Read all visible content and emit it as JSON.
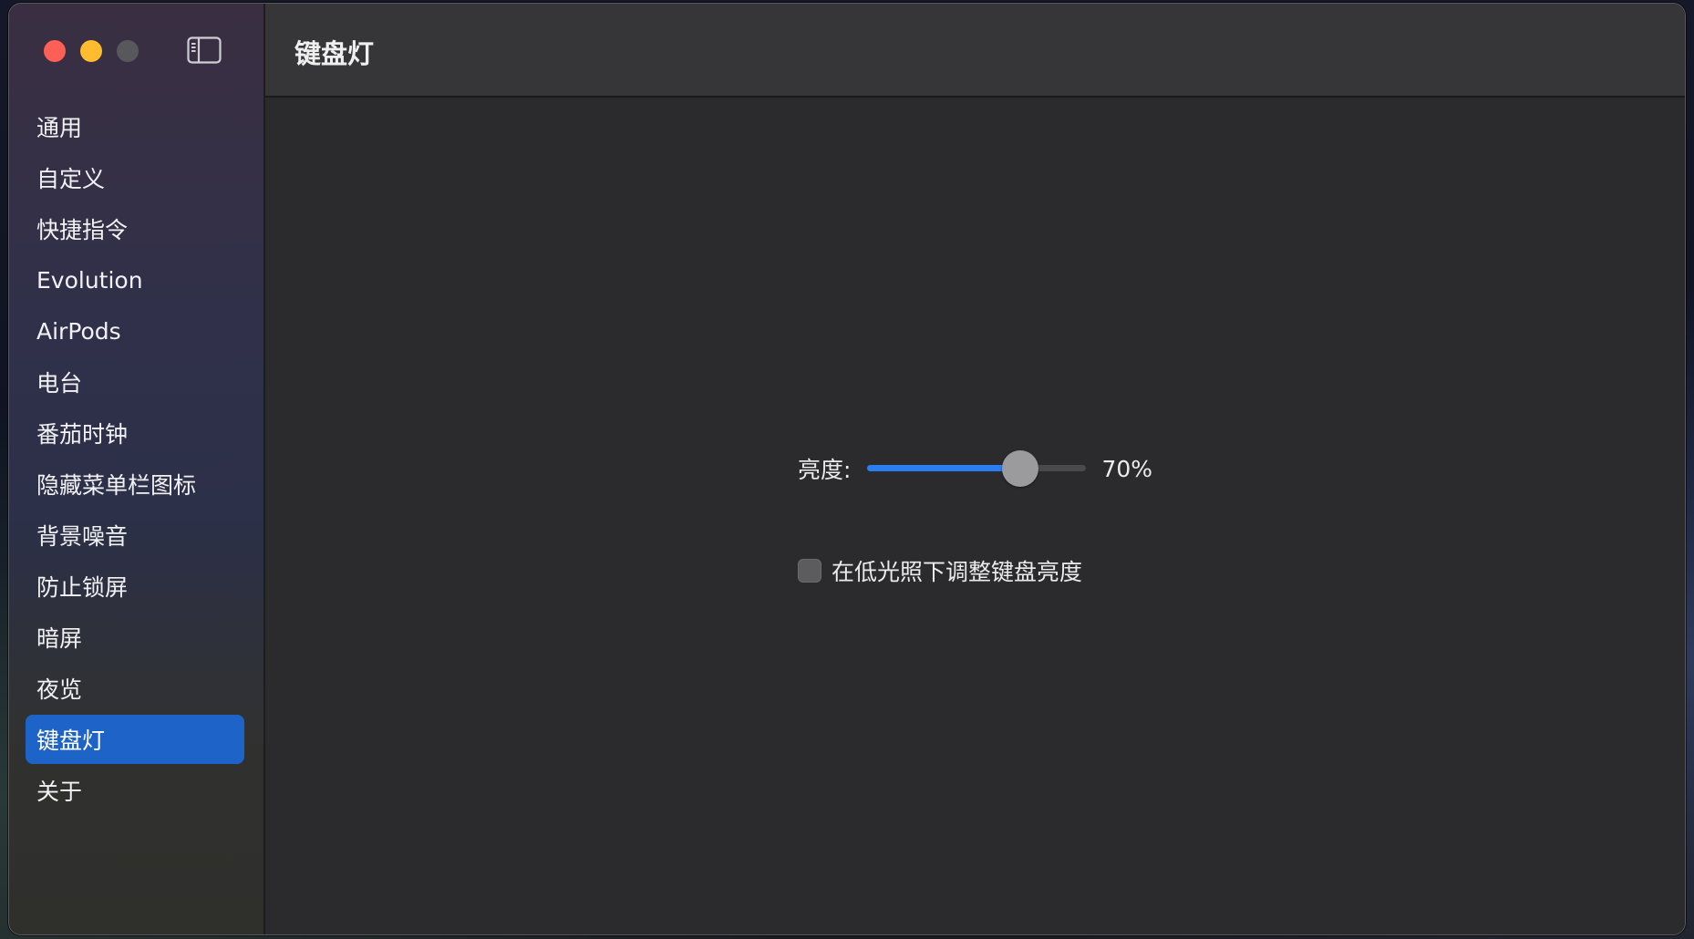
{
  "window": {
    "title": "键盘灯"
  },
  "sidebar": {
    "toggle_icon": "sidebar-left-icon",
    "items": [
      {
        "label": "通用",
        "selected": false
      },
      {
        "label": "自定义",
        "selected": false
      },
      {
        "label": "快捷指令",
        "selected": false
      },
      {
        "label": "Evolution",
        "selected": false
      },
      {
        "label": "AirPods",
        "selected": false
      },
      {
        "label": "电台",
        "selected": false
      },
      {
        "label": "番茄时钟",
        "selected": false
      },
      {
        "label": "隐藏菜单栏图标",
        "selected": false
      },
      {
        "label": "背景噪音",
        "selected": false
      },
      {
        "label": "防止锁屏",
        "selected": false
      },
      {
        "label": "暗屏",
        "selected": false
      },
      {
        "label": "夜览",
        "selected": false
      },
      {
        "label": "键盘灯",
        "selected": true
      },
      {
        "label": "关于",
        "selected": false
      }
    ]
  },
  "main": {
    "brightness": {
      "label": "亮度:",
      "value": 0.7,
      "value_text": "70%"
    },
    "auto_adjust": {
      "label": "在低光照下调整键盘亮度",
      "checked": false
    }
  },
  "colors": {
    "accent": "#1e63c8",
    "slider_fill": "#2a7ef1",
    "close": "#fe5f57",
    "minimize": "#febc2e",
    "zoom_inactive": "#58575c"
  }
}
